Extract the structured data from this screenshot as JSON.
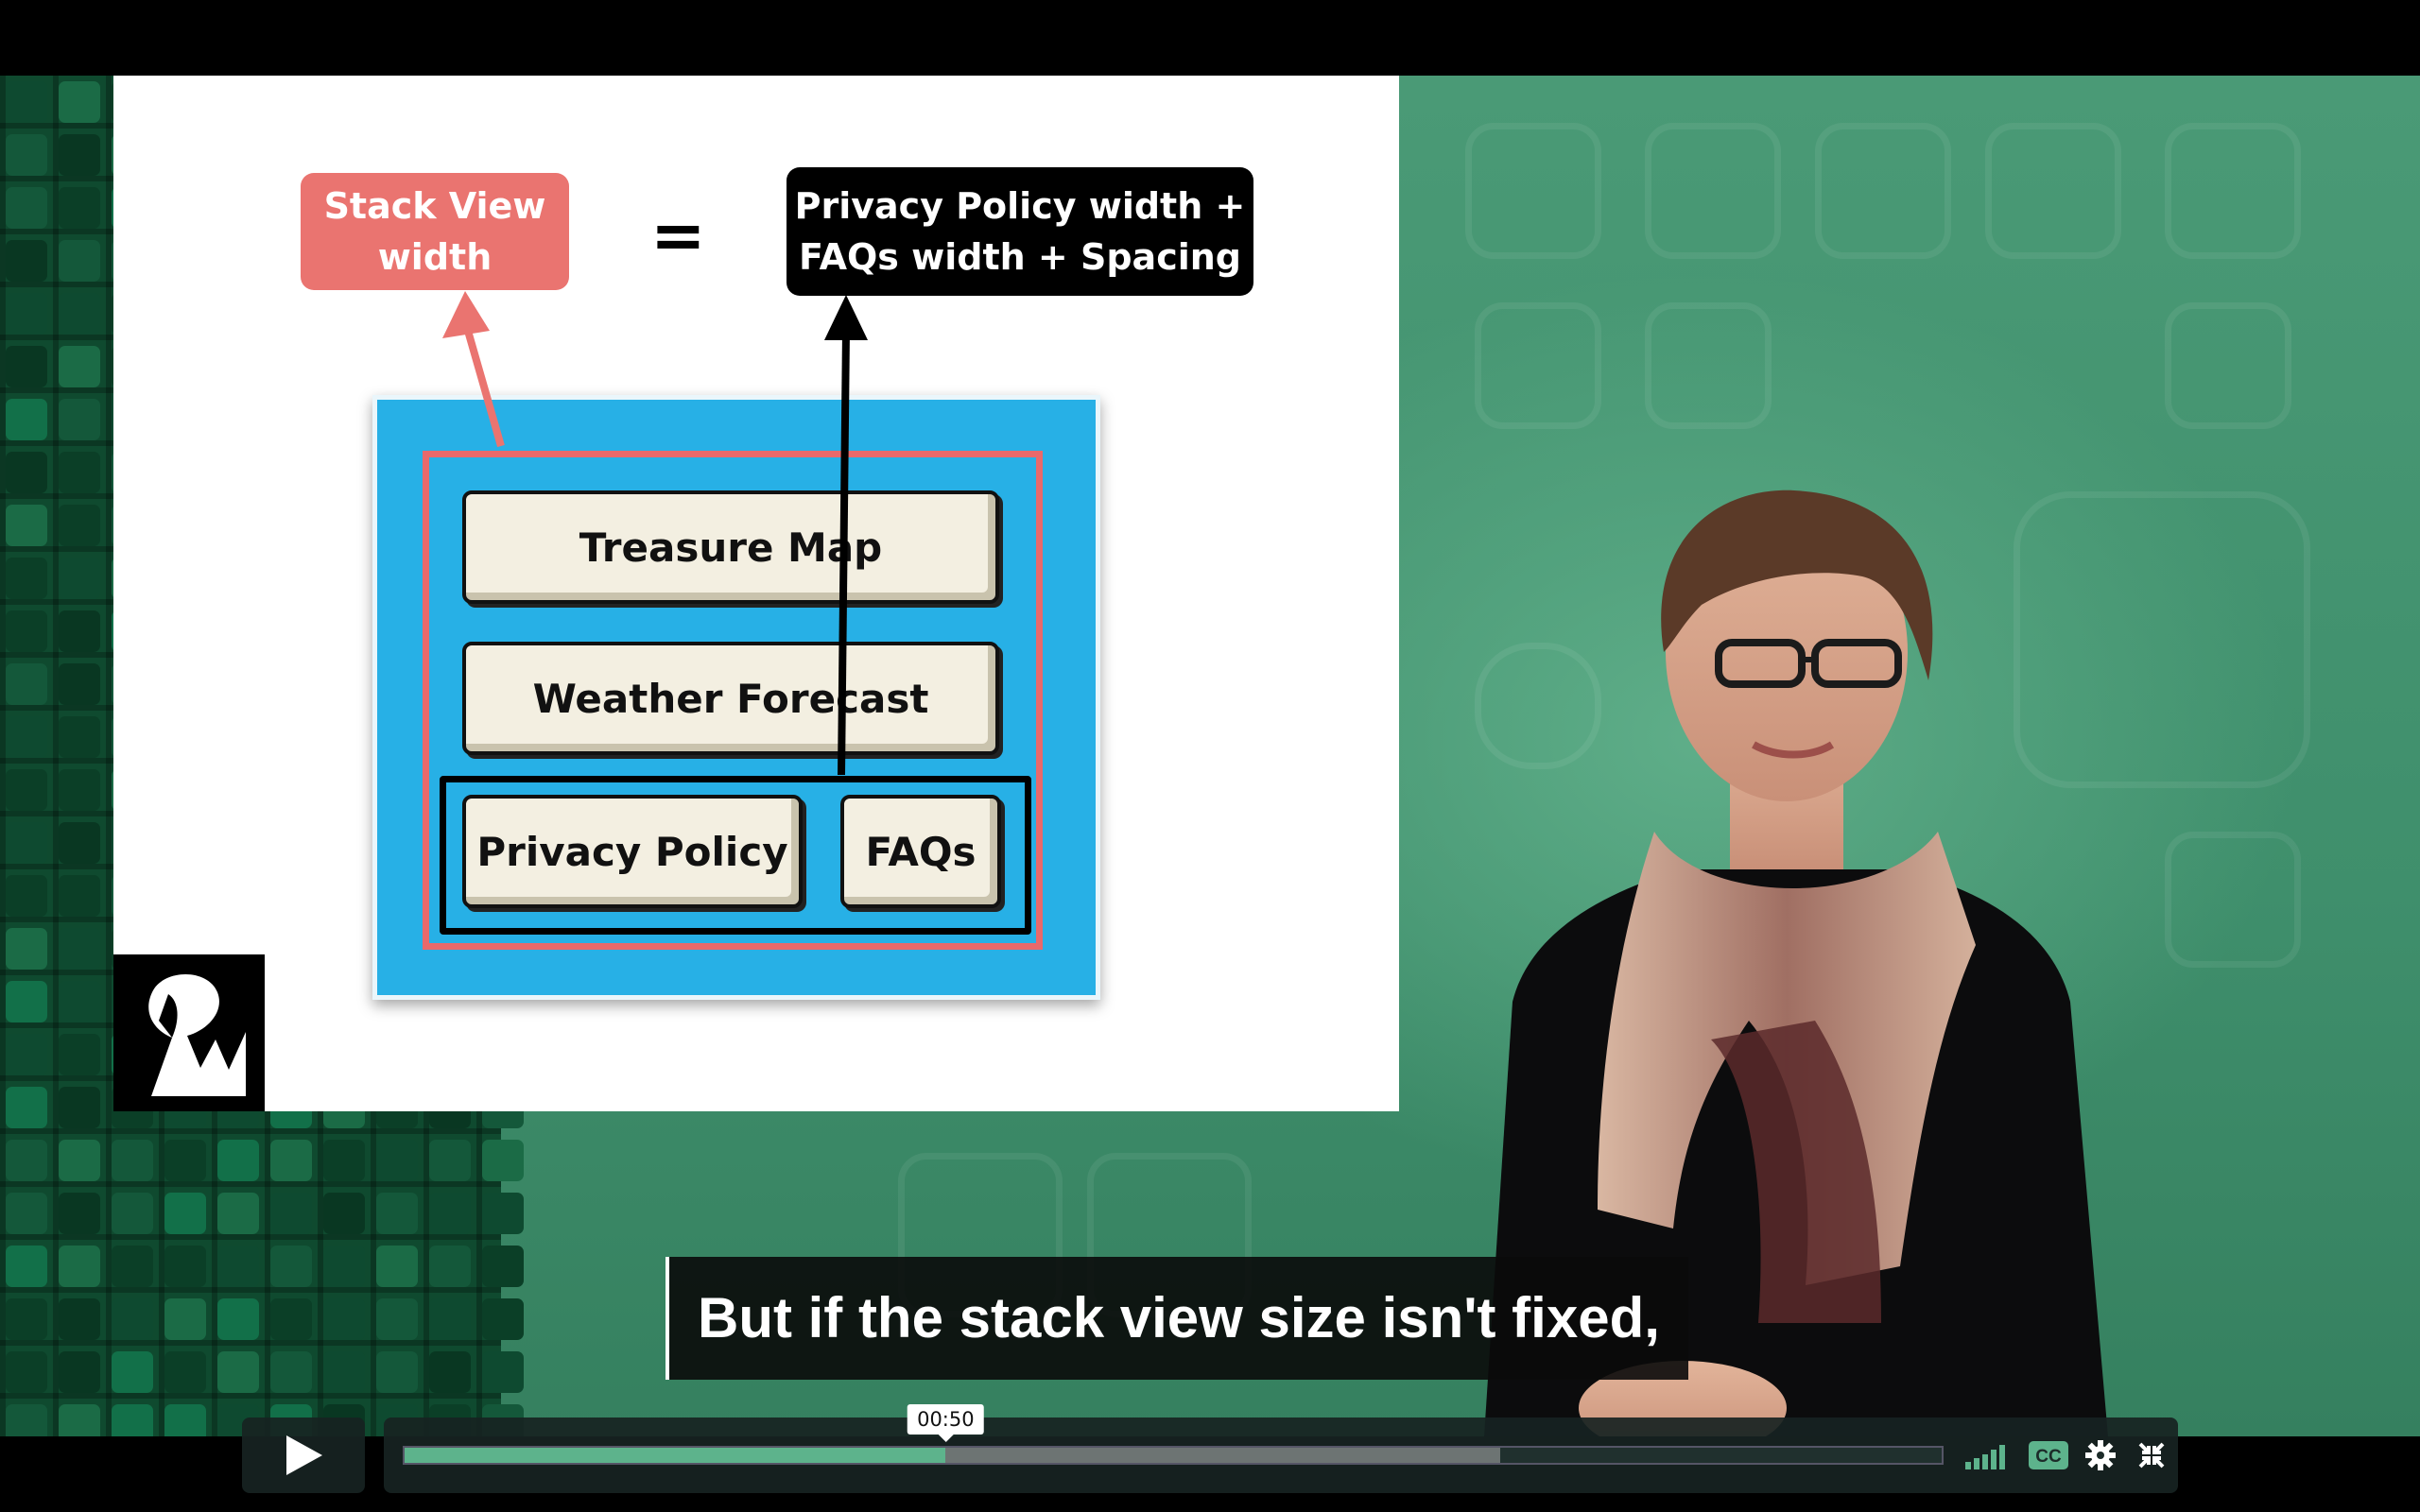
{
  "slide": {
    "left_tag": "Stack View width",
    "left_tag_line1": "Stack View",
    "left_tag_line2": "width",
    "equals": "=",
    "right_tag_line1": "Privacy Policy width +",
    "right_tag_line2": "FAQs width + Spacing",
    "diagram": {
      "items": [
        "Treasure Map",
        "Weather Forecast"
      ],
      "row_items": [
        "Privacy Policy",
        "FAQs"
      ]
    },
    "logo_icon": "raywenderlich-logo"
  },
  "caption": "But if the stack view size isn't fixed,",
  "player": {
    "play_icon": "play-icon",
    "progress": {
      "played_fraction": 0.352,
      "buffered_fraction": 0.713,
      "hover_time": "00:50"
    },
    "volume_icon": "volume-bars-icon",
    "cc_label": "CC",
    "settings_icon": "gear-icon",
    "fullscreen_icon": "exit-fullscreen-icon"
  },
  "colors": {
    "accent_green": "#5db38c",
    "tag_red": "#ea7470",
    "diagram_blue": "#27b0e6"
  }
}
